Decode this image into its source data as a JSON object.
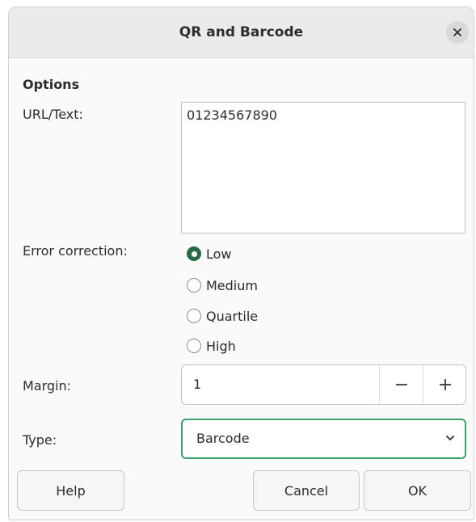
{
  "dialog": {
    "title": "QR and Barcode",
    "close_icon": "close-icon"
  },
  "options": {
    "heading": "Options",
    "url_label": "URL/Text:",
    "url_value": "01234567890",
    "error_label": "Error correction:",
    "error_options": [
      {
        "label": "Low",
        "checked": true
      },
      {
        "label": "Medium",
        "checked": false
      },
      {
        "label": "Quartile",
        "checked": false
      },
      {
        "label": "High",
        "checked": false
      }
    ],
    "margin_label": "Margin:",
    "margin_value": "1",
    "margin_minus": "−",
    "margin_plus": "+",
    "type_label": "Type:",
    "type_value": "Barcode",
    "type_arrow_icon": "chevron-down-icon"
  },
  "buttons": {
    "help": "Help",
    "cancel": "Cancel",
    "ok": "OK"
  },
  "colors": {
    "accent": "#2a6b47",
    "focus_border": "#3aa36b",
    "titlebar": "#ebebeb"
  }
}
